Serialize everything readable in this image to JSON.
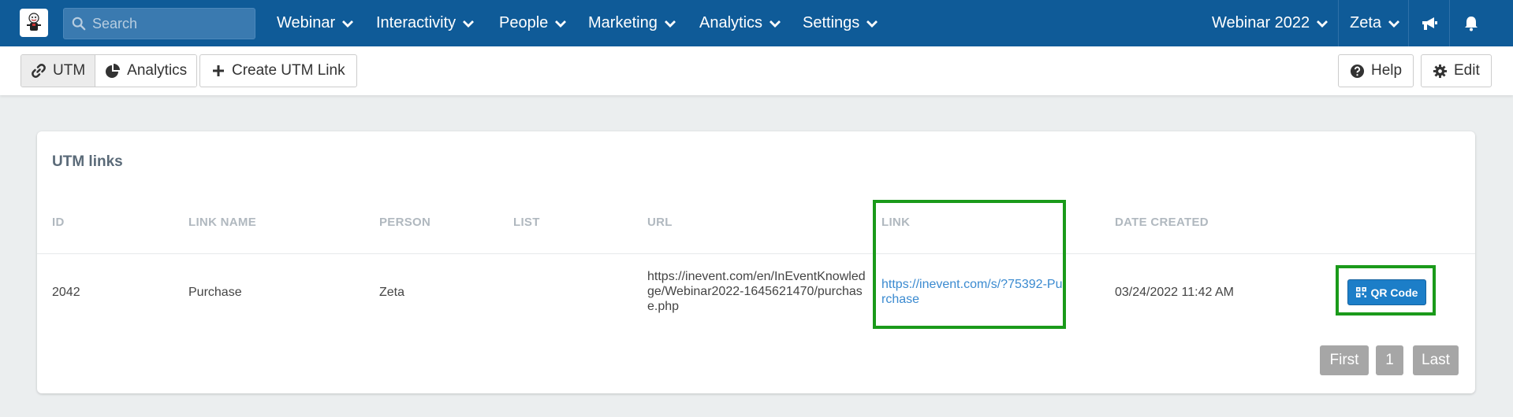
{
  "nav": {
    "search_placeholder": "Search",
    "menus": [
      {
        "label": "Webinar"
      },
      {
        "label": "Interactivity"
      },
      {
        "label": "People"
      },
      {
        "label": "Marketing"
      },
      {
        "label": "Analytics"
      },
      {
        "label": "Settings"
      }
    ],
    "event_selector": "Webinar 2022",
    "user": "Zeta"
  },
  "toolbar": {
    "utm_label": "UTM",
    "analytics_label": "Analytics",
    "create_label": "Create UTM Link",
    "help_label": "Help",
    "edit_label": "Edit"
  },
  "card": {
    "title": "UTM links",
    "headers": {
      "id": "ID",
      "link_name": "LINK NAME",
      "person": "PERSON",
      "list": "LIST",
      "url": "URL",
      "link": "LINK",
      "date_created": "DATE CREATED"
    },
    "rows": [
      {
        "id": "2042",
        "link_name": "Purchase",
        "person": "Zeta",
        "list": "",
        "url": "https://inevent.com/en/InEventKnowledge/Webinar2022-1645621470/purchase.php",
        "link": "https://inevent.com/s/?75392-Purchase",
        "date_created": "03/24/2022 11:42 AM",
        "action_label": "QR Code"
      }
    ],
    "pagination": {
      "first": "First",
      "page": "1",
      "last": "Last"
    }
  },
  "colors": {
    "nav_bg": "#0f5b98",
    "highlight": "#1a9a1a",
    "primary_button": "#1c7ec8",
    "link": "#3a8ad0"
  }
}
